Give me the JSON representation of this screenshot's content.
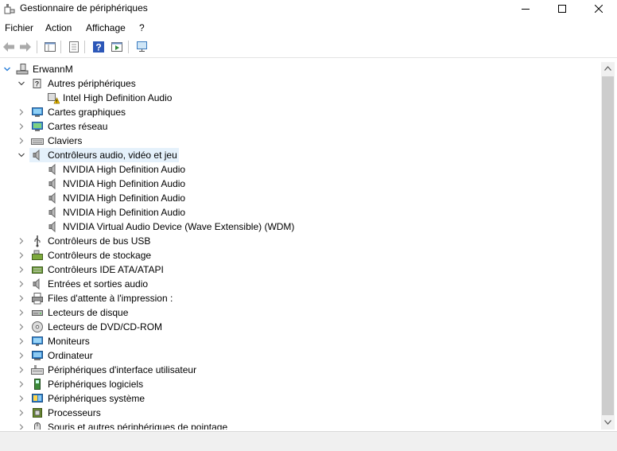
{
  "window": {
    "title": "Gestionnaire de périphériques",
    "app_icon": "device-manager-icon",
    "controls": [
      "minimize-icon",
      "maximize-icon",
      "close-icon"
    ]
  },
  "menu": [
    "Fichier",
    "Action",
    "Affichage",
    "?"
  ],
  "toolbar": {
    "icons": [
      "back-arrow-icon",
      "forward-arrow-icon",
      "console-tree-icon",
      "properties-icon",
      "help-icon",
      "run-icon",
      "scan-hardware-icon"
    ]
  },
  "tree": {
    "root": "ErwannM",
    "items": [
      {
        "label": "Autres périphériques",
        "expanded": true,
        "icon": "unknown-device-icon",
        "children": [
          {
            "label": "Intel High Definition Audio",
            "icon": "warning-device-icon"
          }
        ]
      },
      {
        "label": "Cartes graphiques",
        "expanded": false,
        "icon": "display-adapter-icon"
      },
      {
        "label": "Cartes réseau",
        "expanded": false,
        "icon": "network-adapter-icon"
      },
      {
        "label": "Claviers",
        "expanded": false,
        "icon": "keyboard-icon"
      },
      {
        "label": "Contrôleurs audio, vidéo et jeu",
        "expanded": true,
        "selected": true,
        "icon": "speaker-icon",
        "children": [
          {
            "label": "NVIDIA High Definition Audio",
            "icon": "speaker-icon"
          },
          {
            "label": "NVIDIA High Definition Audio",
            "icon": "speaker-icon"
          },
          {
            "label": "NVIDIA High Definition Audio",
            "icon": "speaker-icon"
          },
          {
            "label": "NVIDIA High Definition Audio",
            "icon": "speaker-icon"
          },
          {
            "label": "NVIDIA Virtual Audio Device (Wave Extensible) (WDM)",
            "icon": "speaker-icon"
          }
        ]
      },
      {
        "label": "Contrôleurs de bus USB",
        "expanded": false,
        "icon": "usb-icon"
      },
      {
        "label": "Contrôleurs de stockage",
        "expanded": false,
        "icon": "storage-controller-icon"
      },
      {
        "label": "Contrôleurs IDE ATA/ATAPI",
        "expanded": false,
        "icon": "ide-controller-icon"
      },
      {
        "label": "Entrées et sorties audio",
        "expanded": false,
        "icon": "speaker-icon"
      },
      {
        "label": "Files d'attente à l'impression :",
        "expanded": false,
        "icon": "printer-icon"
      },
      {
        "label": "Lecteurs de disque",
        "expanded": false,
        "icon": "disk-drive-icon"
      },
      {
        "label": "Lecteurs de DVD/CD-ROM",
        "expanded": false,
        "icon": "dvd-drive-icon"
      },
      {
        "label": "Moniteurs",
        "expanded": false,
        "icon": "monitor-icon"
      },
      {
        "label": "Ordinateur",
        "expanded": false,
        "icon": "computer-icon"
      },
      {
        "label": "Périphériques d'interface utilisateur",
        "expanded": false,
        "icon": "hid-icon"
      },
      {
        "label": "Périphériques logiciels",
        "expanded": false,
        "icon": "software-device-icon"
      },
      {
        "label": "Périphériques système",
        "expanded": false,
        "icon": "system-device-icon"
      },
      {
        "label": "Processeurs",
        "expanded": false,
        "icon": "processor-icon"
      },
      {
        "label": "Souris et autres périphériques de pointage",
        "expanded": false,
        "icon": "mouse-icon"
      }
    ]
  },
  "colors": {
    "selection": "#e5f1fb",
    "accent_blue": "#1e78d7",
    "chevron": "#444444"
  }
}
